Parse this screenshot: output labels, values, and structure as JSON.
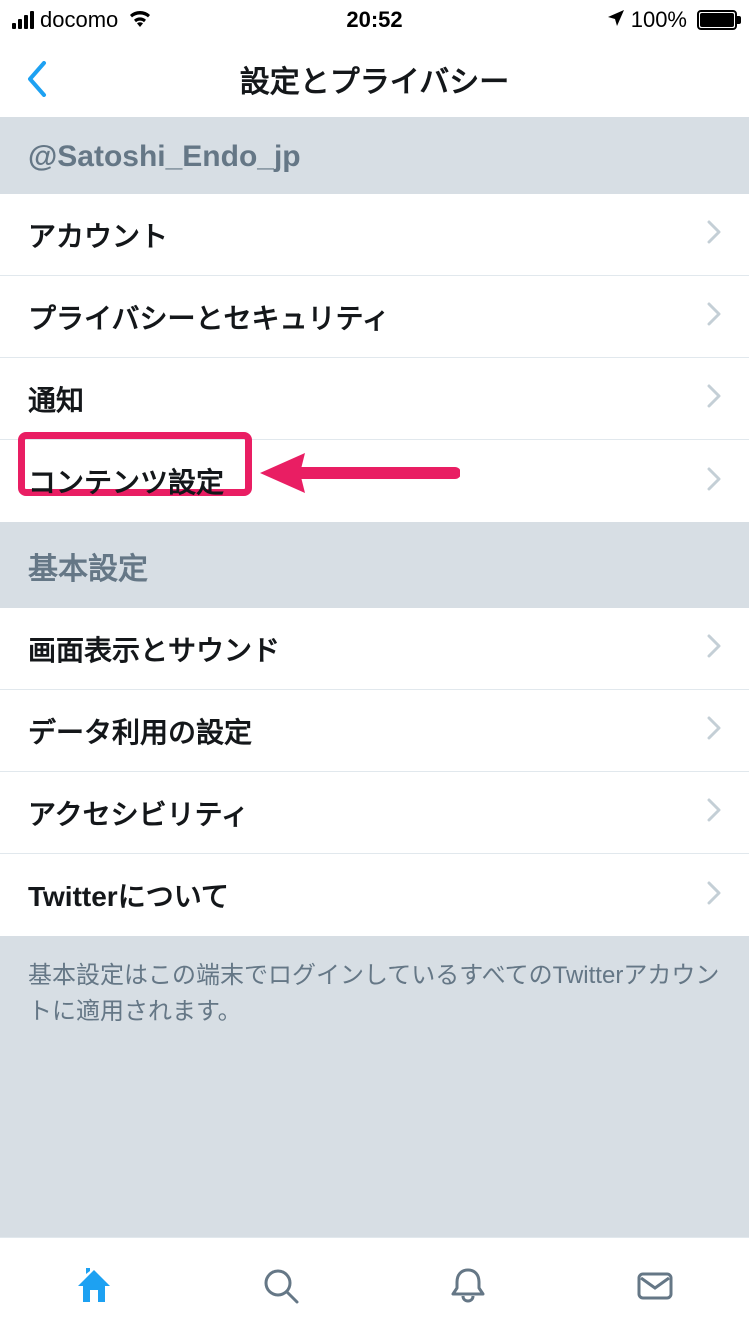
{
  "statusbar": {
    "carrier": "docomo",
    "time": "20:52",
    "battery_pct": "100%"
  },
  "nav": {
    "title": "設定とプライバシー"
  },
  "account_handle": "@Satoshi_Endo_jp",
  "section1": {
    "items": [
      {
        "label": "アカウント"
      },
      {
        "label": "プライバシーとセキュリティ"
      },
      {
        "label": "通知"
      },
      {
        "label": "コンテンツ設定",
        "highlighted": true
      }
    ]
  },
  "section2": {
    "title": "基本設定",
    "items": [
      {
        "label": "画面表示とサウンド"
      },
      {
        "label": "データ利用の設定"
      },
      {
        "label": "アクセシビリティ"
      },
      {
        "label": "Twitterについて"
      }
    ],
    "footer": "基本設定はこの端末でログインしているすべてのTwitterアカウントに適用されます。"
  },
  "tabs": [
    "home",
    "search",
    "notifications",
    "messages"
  ]
}
